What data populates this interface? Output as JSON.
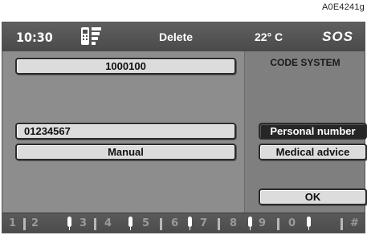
{
  "reference_code": "A0E4241g",
  "status_bar": {
    "time": "10:30",
    "phone_icon": "phone-signal-icon",
    "title": "Delete",
    "temperature": "22° C",
    "sos": "SOS"
  },
  "left": {
    "top_field": "1000100",
    "number_field": "01234567",
    "manual_button": "Manual"
  },
  "right": {
    "label": "CODE SYSTEM",
    "personal_number": "Personal number",
    "medical_advice": "Medical advice",
    "ok": "OK"
  },
  "keypad": {
    "keys": [
      "1",
      "2",
      "3",
      "4",
      "5",
      "6",
      "7",
      "8",
      "9",
      "0",
      "#"
    ],
    "mic_icon": "microphone-icon"
  },
  "colors": {
    "screen_bg": "#8d8d8d",
    "bar_bg": "#4f4f4f",
    "selected_bg": "#262626",
    "button_bg": "#dcdcdc"
  }
}
